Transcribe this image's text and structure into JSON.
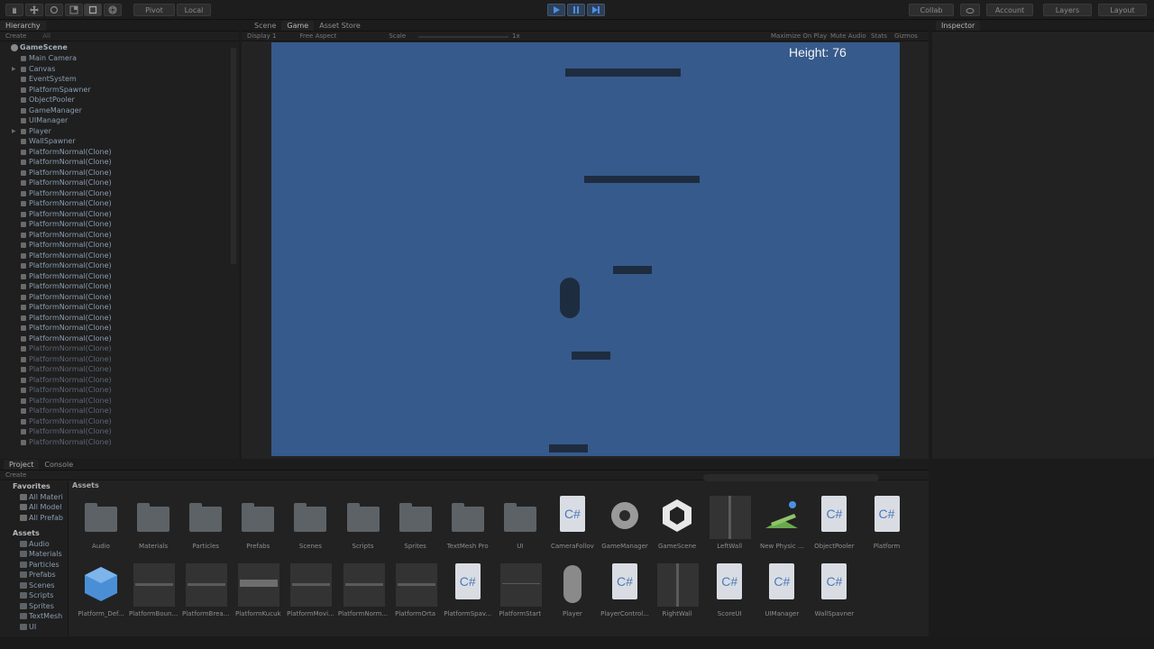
{
  "toolbar": {
    "pivot_label": "Pivot",
    "local_label": "Local",
    "collab_label": "Collab",
    "account_label": "Account",
    "layers_label": "Layers",
    "layout_label": "Layout",
    "accent": "#3f5777"
  },
  "hierarchy": {
    "tab_label": "Hierarchy",
    "create_label": "Create",
    "search_placeholder": "All",
    "scene_name": "GameScene",
    "items": [
      {
        "label": "Main Camera",
        "expandable": false,
        "dim": false
      },
      {
        "label": "Canvas",
        "expandable": true,
        "dim": false
      },
      {
        "label": "EventSystem",
        "expandable": false,
        "dim": false
      },
      {
        "label": "PlatformSpawner",
        "expandable": false,
        "dim": false
      },
      {
        "label": "ObjectPooler",
        "expandable": false,
        "dim": false
      },
      {
        "label": "GameManager",
        "expandable": false,
        "dim": false
      },
      {
        "label": "UIManager",
        "expandable": false,
        "dim": false
      },
      {
        "label": "Player",
        "expandable": true,
        "dim": false
      },
      {
        "label": "WallSpawner",
        "expandable": false,
        "dim": false
      },
      {
        "label": "PlatformNormal(Clone)",
        "expandable": false,
        "dim": false
      },
      {
        "label": "PlatformNormal(Clone)",
        "expandable": false,
        "dim": false
      },
      {
        "label": "PlatformNormal(Clone)",
        "expandable": false,
        "dim": false
      },
      {
        "label": "PlatformNormal(Clone)",
        "expandable": false,
        "dim": false
      },
      {
        "label": "PlatformNormal(Clone)",
        "expandable": false,
        "dim": false
      },
      {
        "label": "PlatformNormal(Clone)",
        "expandable": false,
        "dim": false
      },
      {
        "label": "PlatformNormal(Clone)",
        "expandable": false,
        "dim": false
      },
      {
        "label": "PlatformNormal(Clone)",
        "expandable": false,
        "dim": false
      },
      {
        "label": "PlatformNormal(Clone)",
        "expandable": false,
        "dim": false
      },
      {
        "label": "PlatformNormal(Clone)",
        "expandable": false,
        "dim": false
      },
      {
        "label": "PlatformNormal(Clone)",
        "expandable": false,
        "dim": false
      },
      {
        "label": "PlatformNormal(Clone)",
        "expandable": false,
        "dim": false
      },
      {
        "label": "PlatformNormal(Clone)",
        "expandable": false,
        "dim": false
      },
      {
        "label": "PlatformNormal(Clone)",
        "expandable": false,
        "dim": false
      },
      {
        "label": "PlatformNormal(Clone)",
        "expandable": false,
        "dim": false
      },
      {
        "label": "PlatformNormal(Clone)",
        "expandable": false,
        "dim": false
      },
      {
        "label": "PlatformNormal(Clone)",
        "expandable": false,
        "dim": false
      },
      {
        "label": "PlatformNormal(Clone)",
        "expandable": false,
        "dim": false
      },
      {
        "label": "PlatformNormal(Clone)",
        "expandable": false,
        "dim": false
      },
      {
        "label": "PlatformNormal(Clone)",
        "expandable": false,
        "dim": true
      },
      {
        "label": "PlatformNormal(Clone)",
        "expandable": false,
        "dim": true
      },
      {
        "label": "PlatformNormal(Clone)",
        "expandable": false,
        "dim": true
      },
      {
        "label": "PlatformNormal(Clone)",
        "expandable": false,
        "dim": true
      },
      {
        "label": "PlatformNormal(Clone)",
        "expandable": false,
        "dim": true
      },
      {
        "label": "PlatformNormal(Clone)",
        "expandable": false,
        "dim": true
      },
      {
        "label": "PlatformNormal(Clone)",
        "expandable": false,
        "dim": true
      },
      {
        "label": "PlatformNormal(Clone)",
        "expandable": false,
        "dim": true
      },
      {
        "label": "PlatformNormal(Clone)",
        "expandable": false,
        "dim": true
      },
      {
        "label": "PlatformNormal(Clone)",
        "expandable": false,
        "dim": true
      }
    ]
  },
  "views": {
    "tabs": [
      "Scene",
      "Game",
      "Asset Store"
    ],
    "display_label": "Display 1",
    "aspect_label": "Free Aspect",
    "scale_label": "Scale",
    "scale_value": "1x",
    "maximize_label": "Maximize On Play",
    "mute_label": "Mute Audio",
    "stats_label": "Stats",
    "gizmos_label": "Gizmos"
  },
  "game": {
    "height_text": "Height: 76",
    "bg_color": "#365a8b"
  },
  "inspector": {
    "tab_label": "Inspector"
  },
  "project": {
    "tabs": [
      "Project",
      "Console"
    ],
    "create_label": "Create",
    "breadcrumb": "Assets",
    "favorites_label": "Favorites",
    "favorites": [
      "All Materi",
      "All Model",
      "All Prefab"
    ],
    "assets_label": "Assets",
    "asset_folders": [
      "Audio",
      "Materials",
      "Particles",
      "Prefabs",
      "Scenes",
      "Scripts",
      "Sprites",
      "TextMesh",
      "UI"
    ],
    "row1": [
      {
        "name": "Audio",
        "kind": "folder"
      },
      {
        "name": "Materials",
        "kind": "folder"
      },
      {
        "name": "Particles",
        "kind": "folder"
      },
      {
        "name": "Prefabs",
        "kind": "folder"
      },
      {
        "name": "Scenes",
        "kind": "folder"
      },
      {
        "name": "Scripts",
        "kind": "folder"
      },
      {
        "name": "Sprites",
        "kind": "folder"
      },
      {
        "name": "TextMesh Pro",
        "kind": "folder"
      },
      {
        "name": "UI",
        "kind": "folder"
      },
      {
        "name": "CameraFollov",
        "kind": "script"
      },
      {
        "name": "GameManager",
        "kind": "gear"
      },
      {
        "name": "GameScene",
        "kind": "unity"
      },
      {
        "name": "LeftWall",
        "kind": "wall"
      },
      {
        "name": "New Physic ...",
        "kind": "physic"
      },
      {
        "name": "ObjectPooler",
        "kind": "script"
      },
      {
        "name": "Platform",
        "kind": "script"
      }
    ],
    "row2": [
      {
        "name": "Platform_Def...",
        "kind": "cube"
      },
      {
        "name": "PlatformBoun...",
        "kind": "prefab"
      },
      {
        "name": "PlatformBrea...",
        "kind": "prefab"
      },
      {
        "name": "PlatformKucuk",
        "kind": "prefab-light"
      },
      {
        "name": "PlatformMovi...",
        "kind": "prefab"
      },
      {
        "name": "PlatformNorm...",
        "kind": "prefab"
      },
      {
        "name": "PlatformOrta",
        "kind": "prefab"
      },
      {
        "name": "PlatformSpav...",
        "kind": "script"
      },
      {
        "name": "PlatformStart",
        "kind": "prefab-thin"
      },
      {
        "name": "Player",
        "kind": "capsule"
      },
      {
        "name": "PlayerControl...",
        "kind": "script"
      },
      {
        "name": "RightWall",
        "kind": "wall"
      },
      {
        "name": "ScoreUI",
        "kind": "script"
      },
      {
        "name": "UIManager",
        "kind": "script"
      },
      {
        "name": "WallSpavner",
        "kind": "script"
      }
    ]
  }
}
